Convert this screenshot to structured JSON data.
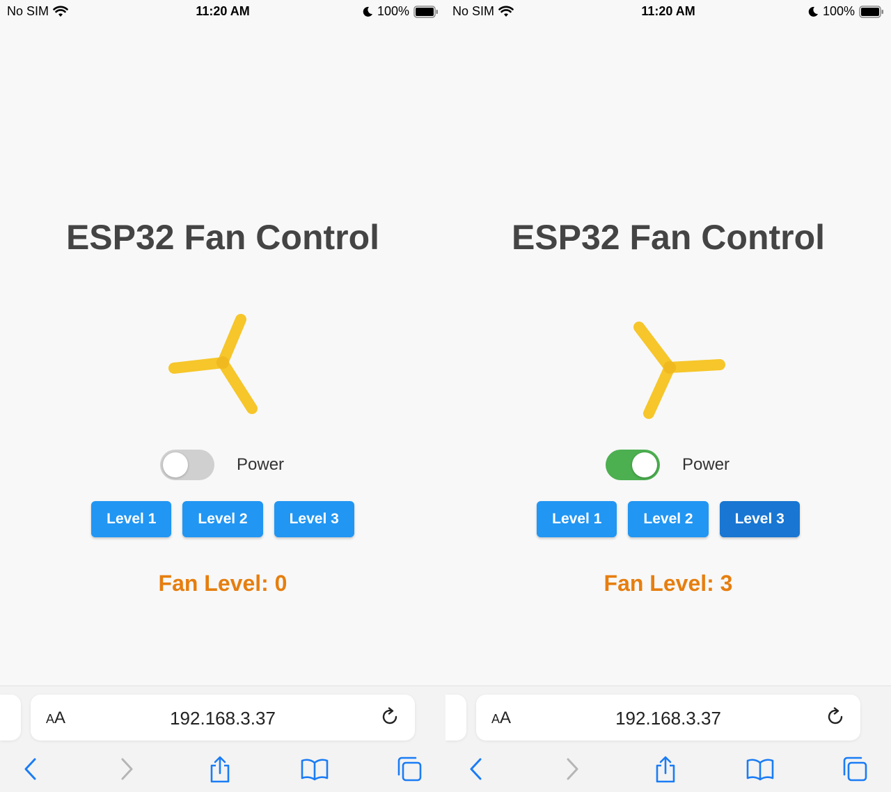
{
  "screens": [
    {
      "status": {
        "carrier": "No SIM",
        "time": "11:20 AM",
        "battery": "100%"
      },
      "title": "ESP32 Fan Control",
      "power": {
        "label": "Power",
        "on": false
      },
      "level_buttons": [
        "Level 1",
        "Level 2",
        "Level 3"
      ],
      "active_level": 0,
      "fan_level_text": "Fan Level: 0",
      "browser": {
        "text_size_label": "AA",
        "url": "192.168.3.37"
      }
    },
    {
      "status": {
        "carrier": "No SIM",
        "time": "11:20 AM",
        "battery": "100%"
      },
      "title": "ESP32 Fan Control",
      "power": {
        "label": "Power",
        "on": true
      },
      "level_buttons": [
        "Level 1",
        "Level 2",
        "Level 3"
      ],
      "active_level": 3,
      "fan_level_text": "Fan Level: 3",
      "browser": {
        "text_size_label": "AA",
        "url": "192.168.3.37"
      }
    }
  ],
  "colors": {
    "button": "#2196f3",
    "button_active": "#1976d2",
    "toggle_on": "#4caf50",
    "toggle_off": "#d0d0d0",
    "fan_blade": "#f6c62a",
    "fan_level_text": "#e67e0f",
    "ios_blue": "#1a7cf5"
  },
  "icons": {
    "wifi": "wifi-icon",
    "moon": "moon-icon",
    "battery": "battery-icon",
    "reload": "reload-icon",
    "back": "chevron-left-icon",
    "forward": "chevron-right-icon",
    "share": "share-icon",
    "bookmarks": "book-icon",
    "tabs": "tabs-icon"
  }
}
